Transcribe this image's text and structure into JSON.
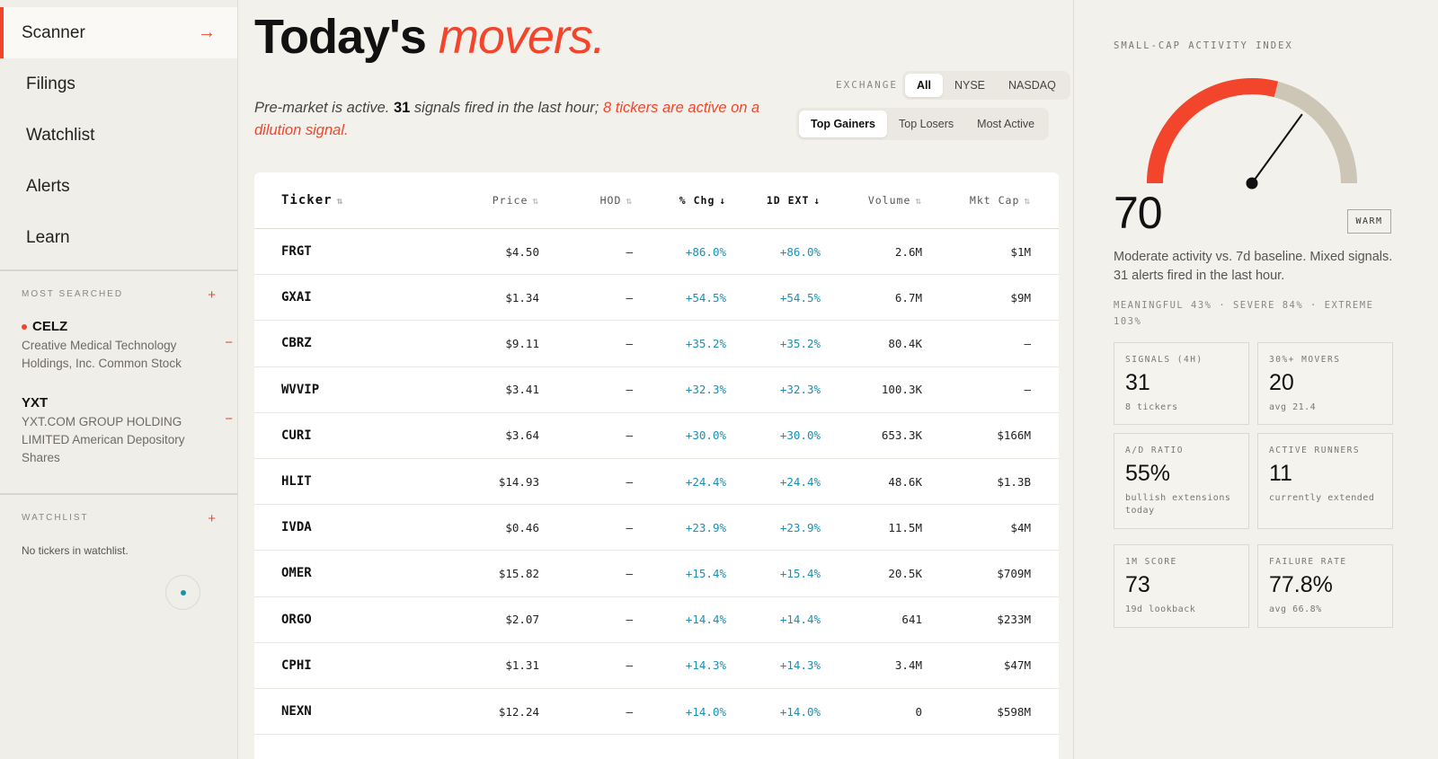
{
  "nav": {
    "items": [
      {
        "label": "Scanner",
        "active": true
      },
      {
        "label": "Filings"
      },
      {
        "label": "Watchlist"
      },
      {
        "label": "Alerts"
      },
      {
        "label": "Learn"
      }
    ],
    "active_arrow": "→"
  },
  "most_searched": {
    "label": "MOST SEARCHED",
    "add": "+",
    "items": [
      {
        "symbol": "CELZ",
        "name": "Creative Medical Technology Holdings, Inc. Common Stock",
        "remove": "−"
      },
      {
        "symbol": "YXT",
        "name": "YXT.COM GROUP HOLDING LIMITED American Depository Shares",
        "remove": "−"
      }
    ]
  },
  "watchlist": {
    "label": "WATCHLIST",
    "add": "+",
    "empty": "No tickers in watchlist."
  },
  "header": {
    "title": "Today's",
    "title_accent": "movers.",
    "subtitle_a": "Pre-market is active.",
    "subtitle_count": "31",
    "subtitle_b": "signals fired in the last hour;",
    "subtitle_red": "8 tickers are active on a dilution signal."
  },
  "exchange": {
    "label": "EXCHANGE",
    "options": [
      "All",
      "NYSE",
      "NASDAQ"
    ],
    "selected": "All"
  },
  "view": {
    "options": [
      "Top Gainers",
      "Top Losers",
      "Most Active"
    ],
    "selected": "Top Gainers"
  },
  "table": {
    "headers": {
      "ticker": "Ticker",
      "price": "Price",
      "hod": "HOD",
      "chg": "% Chg",
      "ext": "1D EXT",
      "vol": "Volume",
      "cap": "Mkt Cap"
    },
    "sort_icons": {
      "unsorted": "⇅",
      "desc": "↓"
    },
    "rows": [
      {
        "ticker": "FRGT",
        "price": "$4.50",
        "hod": "—",
        "chg": "+86.0%",
        "ext": "+86.0%",
        "vol": "2.6M",
        "cap": "$1M"
      },
      {
        "ticker": "GXAI",
        "price": "$1.34",
        "hod": "—",
        "chg": "+54.5%",
        "ext": "+54.5%",
        "vol": "6.7M",
        "cap": "$9M"
      },
      {
        "ticker": "CBRZ",
        "price": "$9.11",
        "hod": "—",
        "chg": "+35.2%",
        "ext": "+35.2%",
        "vol": "80.4K",
        "cap": "—"
      },
      {
        "ticker": "WVVIP",
        "price": "$3.41",
        "hod": "—",
        "chg": "+32.3%",
        "ext": "+32.3%",
        "vol": "100.3K",
        "cap": "—"
      },
      {
        "ticker": "CURI",
        "price": "$3.64",
        "hod": "—",
        "chg": "+30.0%",
        "ext": "+30.0%",
        "vol": "653.3K",
        "cap": "$166M"
      },
      {
        "ticker": "HLIT",
        "price": "$14.93",
        "hod": "—",
        "chg": "+24.4%",
        "ext": "+24.4%",
        "vol": "48.6K",
        "cap": "$1.3B"
      },
      {
        "ticker": "IVDA",
        "price": "$0.46",
        "hod": "—",
        "chg": "+23.9%",
        "ext": "+23.9%",
        "vol": "11.5M",
        "cap": "$4M"
      },
      {
        "ticker": "OMER",
        "price": "$15.82",
        "hod": "—",
        "chg": "+15.4%",
        "ext": "+15.4%",
        "vol": "20.5K",
        "cap": "$709M"
      },
      {
        "ticker": "ORGO",
        "price": "$2.07",
        "hod": "—",
        "chg": "+14.4%",
        "ext": "+14.4%",
        "vol": "641",
        "cap": "$233M"
      },
      {
        "ticker": "CPHI",
        "price": "$1.31",
        "hod": "—",
        "chg": "+14.3%",
        "ext": "+14.3%",
        "vol": "3.4M",
        "cap": "$47M"
      },
      {
        "ticker": "NEXN",
        "price": "$12.24",
        "hod": "—",
        "chg": "+14.0%",
        "ext": "+14.0%",
        "vol": "0",
        "cap": "$598M"
      }
    ]
  },
  "activity": {
    "label": "SMALL-CAP ACTIVITY INDEX",
    "score": "70",
    "score_value": 70,
    "badge": "WARM",
    "description": "Moderate activity vs. 7d baseline. Mixed signals. 31 alerts fired in the last hour.",
    "meta": "MEANINGFUL 43% · SEVERE 84% · EXTREME 103%",
    "colors": {
      "fill": "#f2452c",
      "track": "#cdc6b6",
      "needle": "#111111"
    }
  },
  "cards": [
    {
      "label": "SIGNALS (4H)",
      "value": "31",
      "sub": "8 tickers"
    },
    {
      "label": "30%+ MOVERS",
      "value": "20",
      "sub": "avg 21.4"
    },
    {
      "label": "A/D RATIO",
      "value": "55%",
      "sub": "bullish extensions today"
    },
    {
      "label": "ACTIVE RUNNERS",
      "value": "11",
      "sub": "currently extended"
    },
    {
      "label": "1M SCORE",
      "value": "73",
      "sub": "19d lookback"
    },
    {
      "label": "FAILURE RATE",
      "value": "77.8%",
      "sub": "avg 66.8%"
    }
  ]
}
